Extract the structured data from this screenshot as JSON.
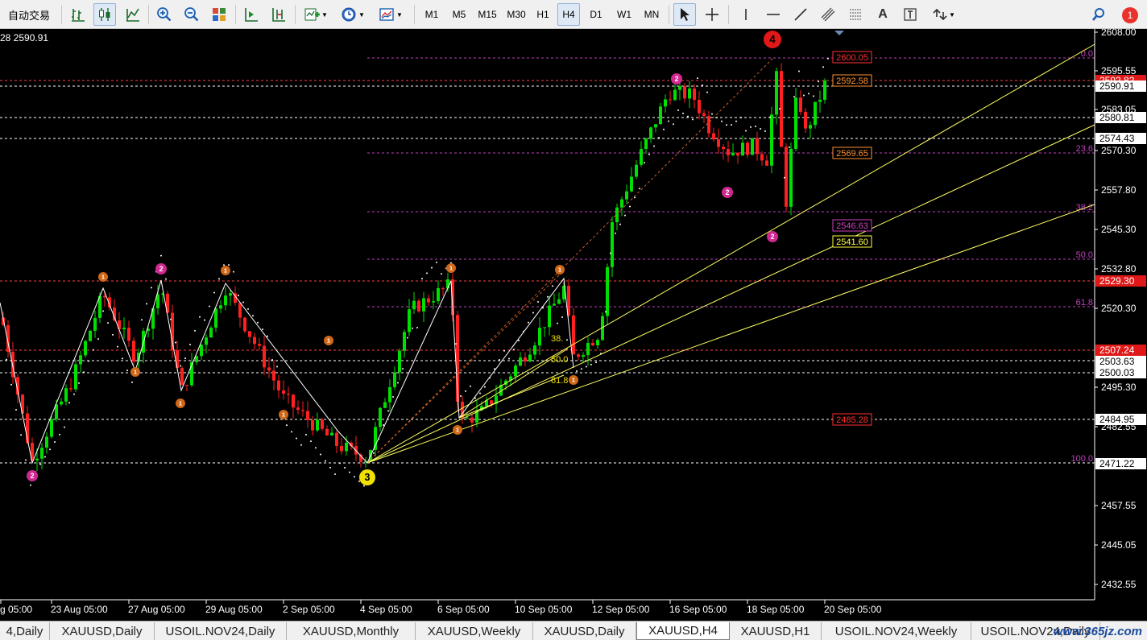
{
  "toolbar": {
    "auto_trade_label": "自动交易",
    "timeframes": [
      "M1",
      "M5",
      "M15",
      "M30",
      "H1",
      "H4",
      "D1",
      "W1",
      "MN"
    ],
    "active_timeframe": "H4",
    "notification_count": "1"
  },
  "chart": {
    "ohlc_header": "28 2590.91",
    "price_ticks": [
      "2608.00",
      "2595.55",
      "2583.05",
      "2570.30",
      "2557.80",
      "2545.30",
      "2532.80",
      "2520.30",
      "2495.30",
      "2482.55",
      "2457.55",
      "2445.05",
      "2432.55"
    ],
    "price_boxes": [
      {
        "label": "2592.82",
        "kind": "red"
      },
      {
        "label": "2590.91",
        "kind": "white"
      },
      {
        "label": "2580.81",
        "kind": "white"
      },
      {
        "label": "2574.43",
        "kind": "white"
      },
      {
        "label": "2529.30",
        "kind": "red"
      },
      {
        "label": "2507.24",
        "kind": "red"
      },
      {
        "label": "2503.63",
        "kind": "white"
      },
      {
        "label": "2500.03",
        "kind": "white"
      },
      {
        "label": "2484.95",
        "kind": "white"
      },
      {
        "label": "2471.22",
        "kind": "white"
      }
    ],
    "date_labels": [
      "g 05:00",
      "23 Aug 05:00",
      "27 Aug 05:00",
      "29 Aug 05:00",
      "2 Sep 05:00",
      "4 Sep 05:00",
      "6 Sep 05:00",
      "10 Sep 05:00",
      "12 Sep 05:00",
      "16 Sep 05:00",
      "18 Sep 05:00",
      "20 Sep 05:00"
    ],
    "fib_labels": [
      "0.0",
      "23.6",
      "38.2",
      "50.0",
      "61.8",
      "100.0"
    ],
    "fib_small_labels": [
      "38.",
      "50.0",
      "61.8"
    ],
    "level_boxes": [
      {
        "label": "2600.05",
        "kind": "red"
      },
      {
        "label": "2592.58",
        "kind": "orange"
      },
      {
        "label": "2569.65",
        "kind": "orange"
      },
      {
        "label": "2546.63",
        "kind": "magenta"
      },
      {
        "label": "2541.60",
        "kind": "yellow"
      },
      {
        "label": "2485.28",
        "kind": "red"
      }
    ],
    "wave_markers": {
      "big3": "3",
      "big4": "4",
      "w2": "2",
      "w1": "1"
    },
    "colors": {
      "bull": "#00e000",
      "bear": "#ff2020",
      "fib": "#c040c0",
      "trend": "#ffff60",
      "wave": "#ffffff"
    }
  },
  "tabs": [
    {
      "label": "4,Daily"
    },
    {
      "label": "XAUUSD,Daily"
    },
    {
      "label": "USOIL.NOV24,Daily"
    },
    {
      "label": "XAUUSD,Monthly"
    },
    {
      "label": "XAUUSD,Weekly"
    },
    {
      "label": "XAUUSD,Daily"
    },
    {
      "label": "XAUUSD,H4"
    },
    {
      "label": "XAUUSD,H1"
    },
    {
      "label": "USOIL.NOV24,Weekly"
    },
    {
      "label": "USOIL.NOV24,Daily"
    }
  ],
  "watermark": "www.365jz.com"
}
